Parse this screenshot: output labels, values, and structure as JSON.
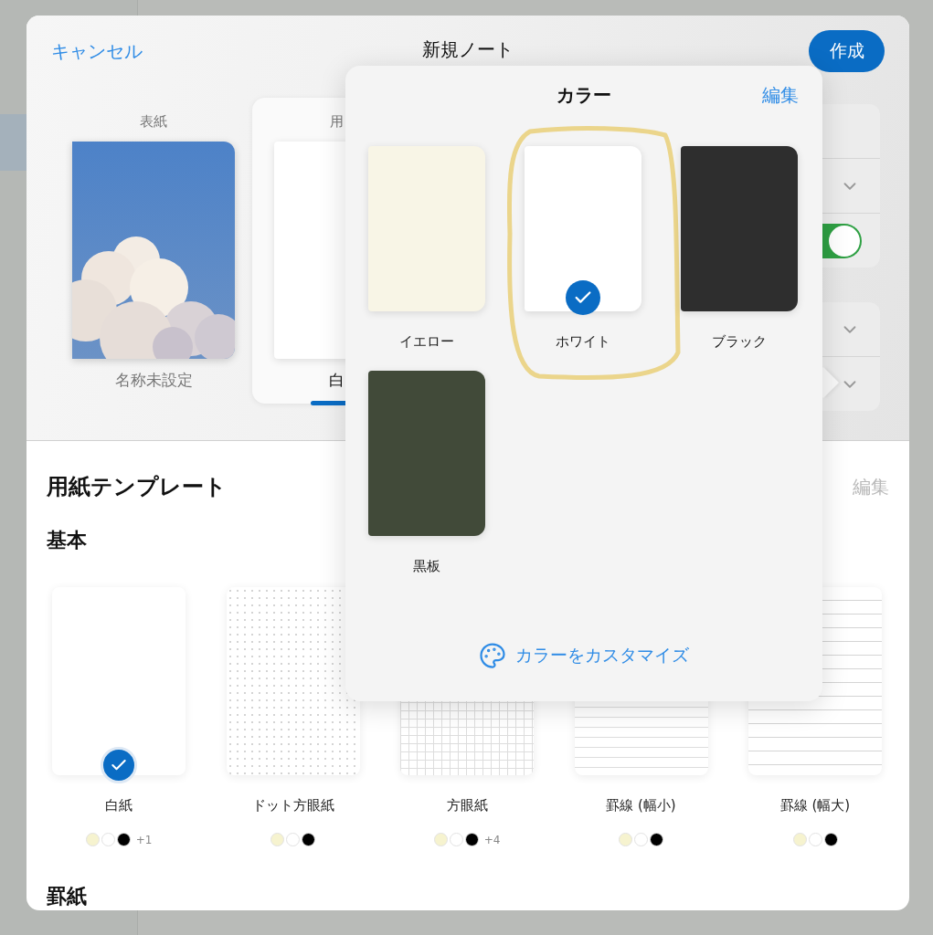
{
  "header": {
    "cancel": "キャンセル",
    "title": "新規ノート",
    "create": "作成"
  },
  "tabs": [
    {
      "kind": "cover",
      "label": "表紙",
      "name": "名称未設定",
      "selected": false
    },
    {
      "kind": "paper",
      "label": "用",
      "name": "白",
      "selected": true
    }
  ],
  "settings": {
    "toggle_on": true
  },
  "templates": {
    "title": "用紙テンプレート",
    "edit": "編集",
    "sections": [
      {
        "title": "基本",
        "items": [
          {
            "name": "白紙",
            "kind": "blank",
            "selected": true,
            "swatches": [
              {
                "color": "#f6f3cf"
              },
              {
                "color": "#ffffff"
              },
              {
                "color": "#000000"
              }
            ],
            "more": "+1"
          },
          {
            "name": "ドット方眼紙",
            "kind": "dots",
            "selected": false,
            "swatches": [
              {
                "color": "#f6f3cf"
              },
              {
                "color": "#ffffff"
              },
              {
                "color": "#000000"
              }
            ]
          },
          {
            "name": "方眼紙",
            "kind": "grid",
            "selected": false,
            "swatches": [
              {
                "color": "#f6f3cf"
              },
              {
                "color": "#ffffff"
              },
              {
                "color": "#000000"
              }
            ],
            "more": "+4"
          },
          {
            "name": "罫線 (幅小)",
            "kind": "narrow",
            "selected": false,
            "swatches": [
              {
                "color": "#f6f3cf"
              },
              {
                "color": "#ffffff"
              },
              {
                "color": "#000000"
              }
            ]
          },
          {
            "name": "罫線 (幅大)",
            "kind": "wide",
            "selected": false,
            "swatches": [
              {
                "color": "#f6f3cf"
              },
              {
                "color": "#ffffff"
              },
              {
                "color": "#000000"
              }
            ]
          }
        ]
      },
      {
        "title": "罫紙"
      }
    ]
  },
  "popover": {
    "title": "カラー",
    "edit": "編集",
    "colors": [
      {
        "name": "イエロー",
        "color": "#f8f5e6",
        "selected": false
      },
      {
        "name": "ホワイト",
        "color": "#ffffff",
        "selected": true
      },
      {
        "name": "ブラック",
        "color": "#2e2e2e",
        "selected": false
      },
      {
        "name": "黒板",
        "color": "#414a39",
        "selected": false
      }
    ],
    "customize": "カラーをカスタマイズ"
  }
}
